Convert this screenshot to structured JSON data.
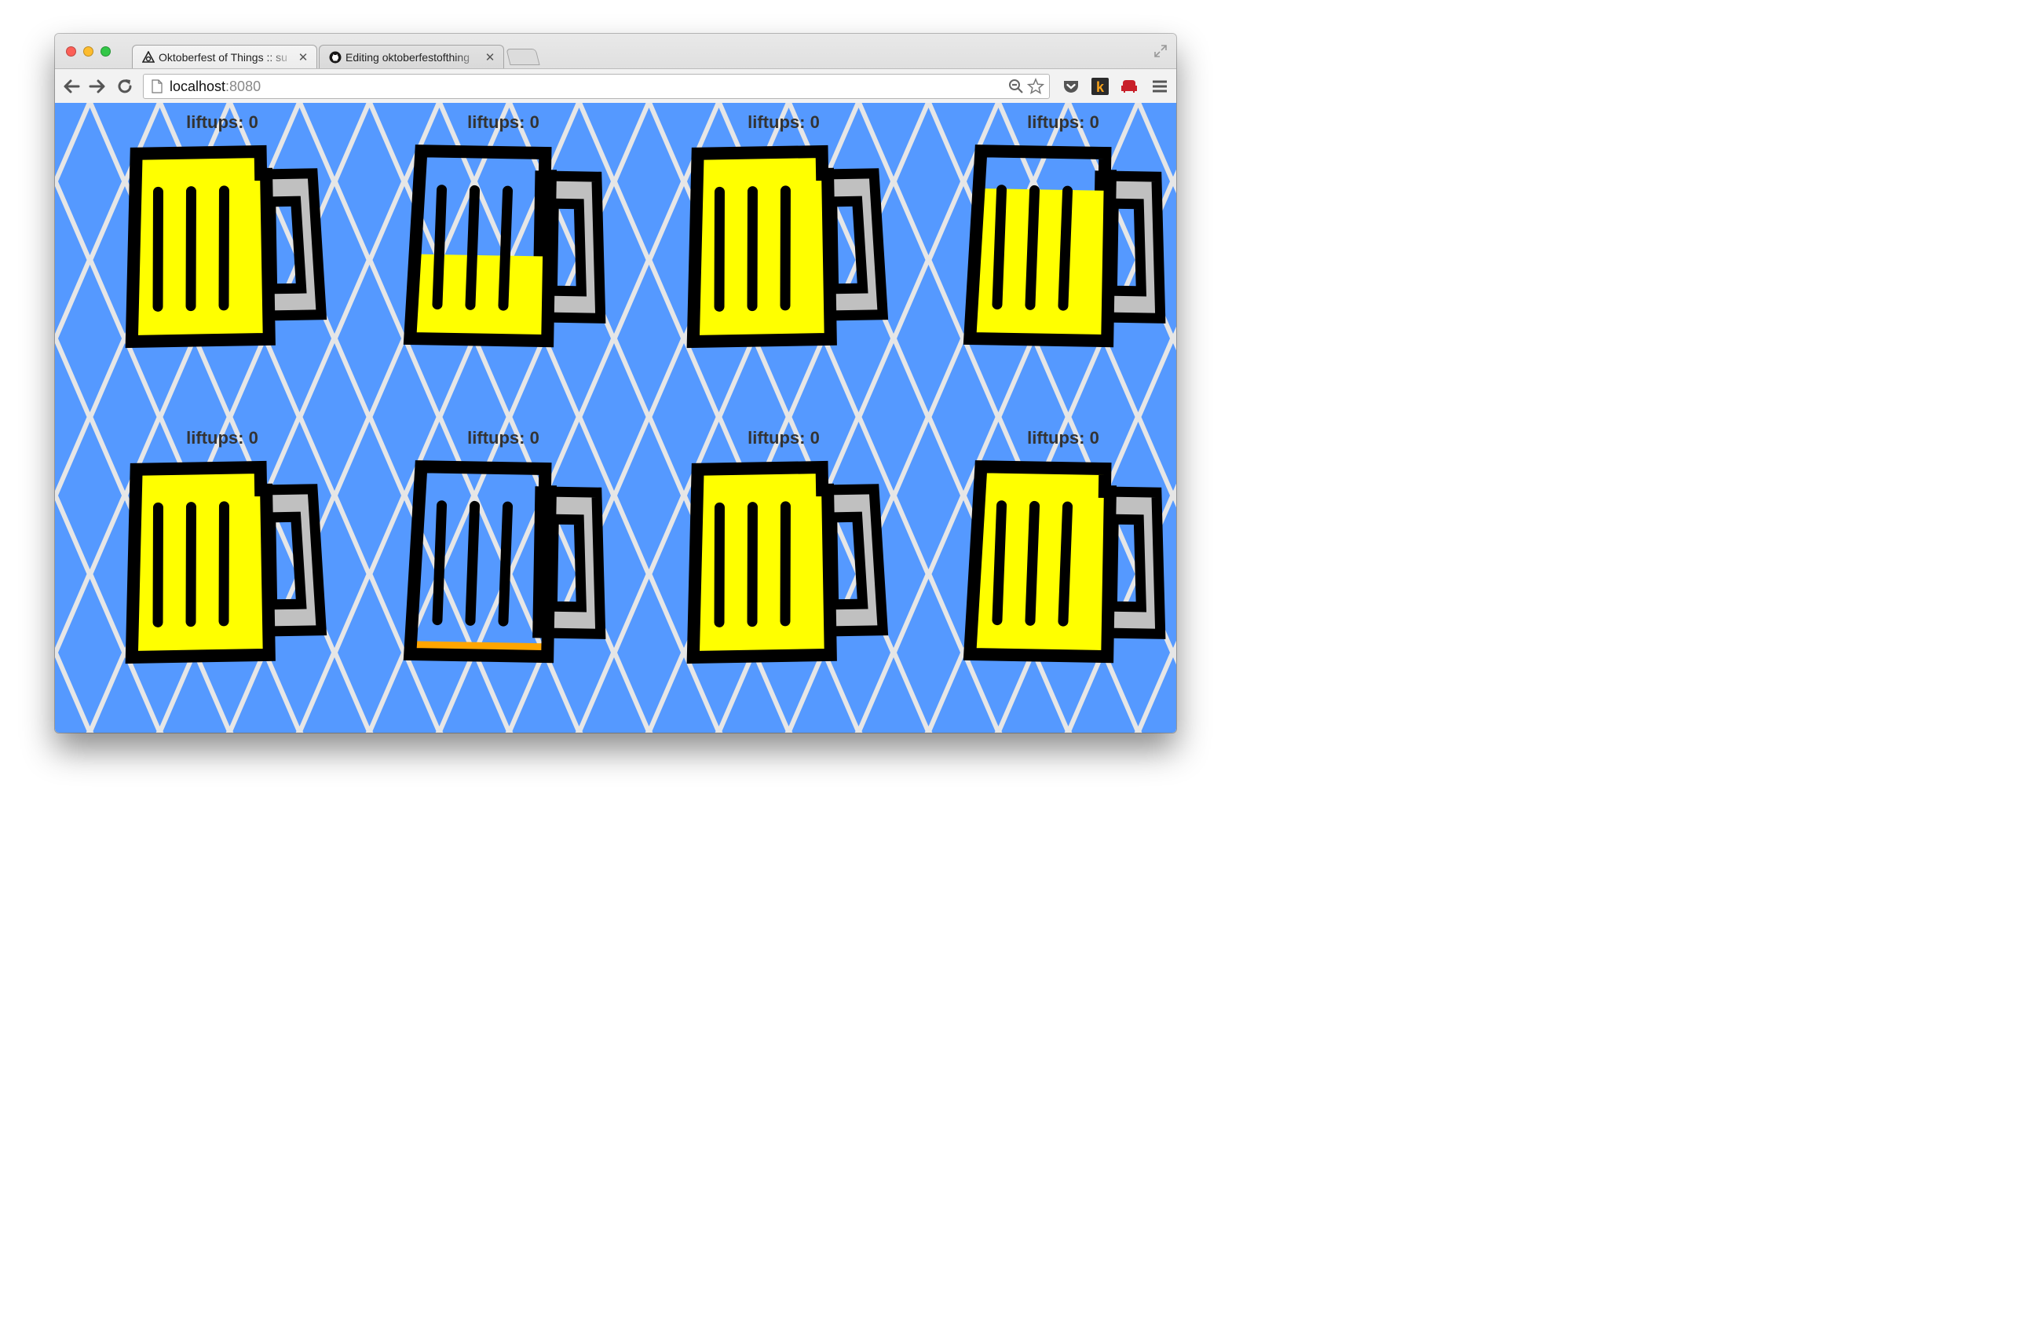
{
  "browser": {
    "tabs": [
      {
        "title": "Oktoberfest of Things :: su",
        "icon": "spiral-logo-icon",
        "active": true
      },
      {
        "title": "Editing oktoberfestofthing",
        "icon": "github-icon",
        "active": false
      }
    ],
    "url_host": "localhost",
    "url_port": ":8080"
  },
  "pattern": {
    "blue": "#5599ff",
    "white": "#e6e6e6"
  },
  "colors": {
    "beer": "#ffff00",
    "low_beer": "#ffa500",
    "glass_handle": "#c0c0c0",
    "outline": "#000000"
  },
  "mugs": [
    {
      "label": "liftups: 0",
      "fill_level": 1.0,
      "tilt": -1,
      "beer_color": "#ffff00"
    },
    {
      "label": "liftups: 0",
      "fill_level": 0.45,
      "tilt": 1,
      "beer_color": "#ffff00"
    },
    {
      "label": "liftups: 0",
      "fill_level": 1.0,
      "tilt": -1,
      "beer_color": "#ffff00"
    },
    {
      "label": "liftups: 0",
      "fill_level": 0.8,
      "tilt": 1,
      "beer_color": "#ffff00"
    },
    {
      "label": "liftups: 0",
      "fill_level": 1.0,
      "tilt": -1,
      "beer_color": "#ffff00"
    },
    {
      "label": "liftups: 0",
      "fill_level": 0.07,
      "tilt": 1,
      "beer_color": "#ffa500"
    },
    {
      "label": "liftups: 0",
      "fill_level": 1.0,
      "tilt": -1,
      "beer_color": "#ffff00"
    },
    {
      "label": "liftups: 0",
      "fill_level": 1.0,
      "tilt": 1,
      "beer_color": "#ffff00"
    }
  ]
}
